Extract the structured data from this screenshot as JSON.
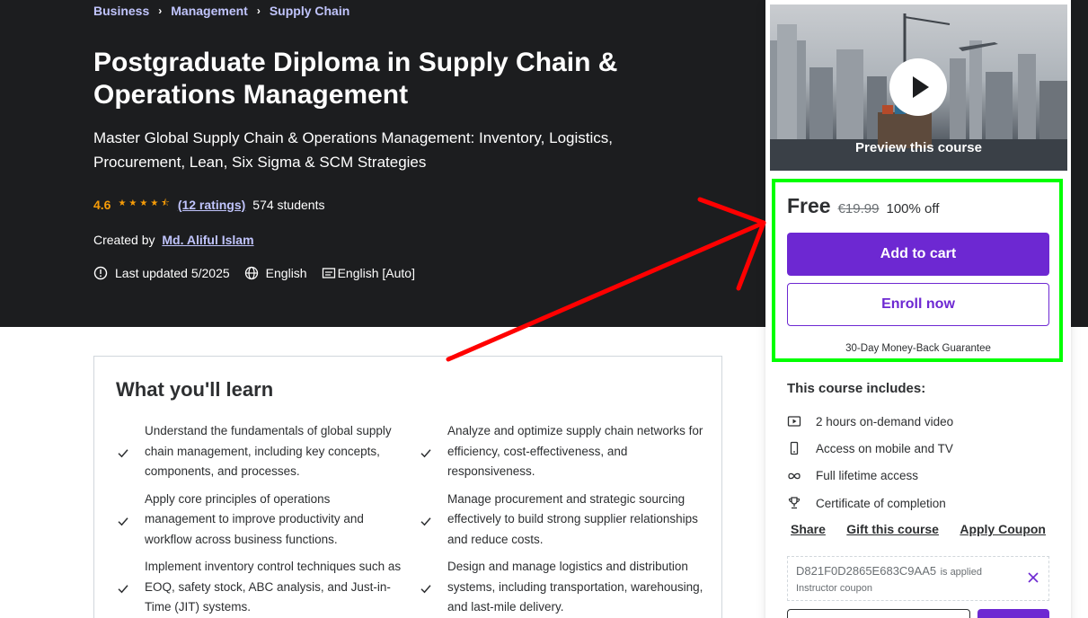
{
  "breadcrumb": [
    "Business",
    "Management",
    "Supply Chain"
  ],
  "course": {
    "title": "Postgraduate Diploma in Supply Chain & Operations Management",
    "subtitle": "Master Global Supply Chain & Operations Management: Inventory, Logistics, Procurement, Lean, Six Sigma & SCM Strategies",
    "rating": "4.6",
    "stars_value": 4.5,
    "ratings_count": "(12 ratings)",
    "students": "574 students",
    "created_by_label": "Created by",
    "instructor": "Md. Aliful Islam",
    "last_updated": "Last updated 5/2025",
    "language": "English",
    "captions": "English [Auto]"
  },
  "learn": {
    "title": "What you'll learn",
    "items": [
      "Understand the fundamentals of global supply chain management, including key concepts, components, and processes.",
      "Analyze and optimize supply chain networks for efficiency, cost-effectiveness, and responsiveness.",
      "Apply core principles of operations management to improve productivity and workflow across business functions.",
      "Manage procurement and strategic sourcing effectively to build strong supplier relationships and reduce costs.",
      "Implement inventory control techniques such as EOQ, safety stock, ABC analysis, and Just-in-Time (JIT) systems.",
      "Design and manage logistics and distribution systems, including transportation, warehousing, and last-mile delivery."
    ]
  },
  "sidebar": {
    "preview_label": "Preview this course",
    "price_free": "Free",
    "price_original": "€19.99",
    "discount": "100% off",
    "add_to_cart": "Add to cart",
    "enroll_now": "Enroll now",
    "guarantee": "30-Day Money-Back Guarantee",
    "includes_title": "This course includes:",
    "includes": [
      {
        "icon": "video-icon",
        "label": "2 hours on-demand video"
      },
      {
        "icon": "mobile-icon",
        "label": "Access on mobile and TV"
      },
      {
        "icon": "infinity-icon",
        "label": "Full lifetime access"
      },
      {
        "icon": "trophy-icon",
        "label": "Certificate of completion"
      }
    ],
    "share": "Share",
    "gift": "Gift this course",
    "apply_coupon": "Apply Coupon",
    "coupon_code": "D821F0D2865E683C9AA5",
    "coupon_applied": "is applied",
    "coupon_type": "Instructor coupon"
  },
  "colors": {
    "hero_bg": "#1c1d1f",
    "link_purple": "#c0c4fc",
    "star": "#f69c08",
    "primary": "#6d28d2",
    "highlight_box": "#00ff00",
    "annotation_arrow": "#ff0000"
  }
}
